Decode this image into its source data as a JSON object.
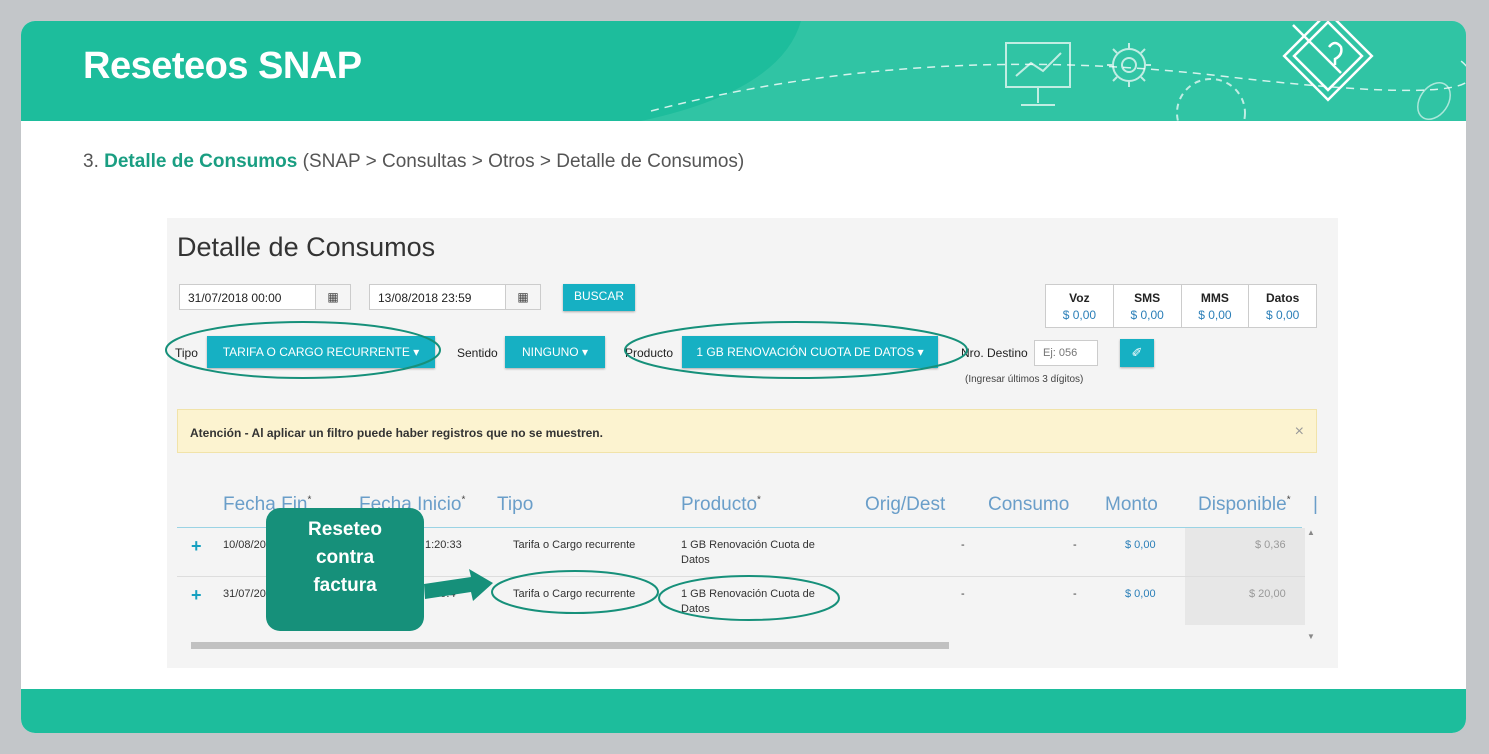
{
  "slide": {
    "title": "Reseteos SNAP",
    "subtitle_num": "3.",
    "subtitle_highlight": "Detalle de Consumos",
    "subtitle_path": "(SNAP > Consultas > Otros > Detalle de Consumos)",
    "accent_color": "#1dbd9c",
    "decor_icons": [
      "presentation-board-icon",
      "gear-icon",
      "pencil-question-icon",
      "mouse-icon"
    ]
  },
  "app": {
    "title": "Detalle de Consumos",
    "date_from": "31/07/2018 00:00",
    "date_to": "13/08/2018 23:59",
    "calendar_icon": "calendar-icon",
    "search_label": "BUSCAR",
    "summary": [
      {
        "label": "Voz",
        "value": "$ 0,00"
      },
      {
        "label": "SMS",
        "value": "$ 0,00"
      },
      {
        "label": "MMS",
        "value": "$ 0,00"
      },
      {
        "label": "Datos",
        "value": "$ 0,00"
      }
    ],
    "filters": {
      "tipo_label": "Tipo",
      "tipo_value": "TARIFA O CARGO RECURRENTE",
      "sentido_label": "Sentido",
      "sentido_value": "NINGUNO",
      "producto_label": "Producto",
      "producto_value": "1 GB RENOVACIÓN CUOTA DE DATOS",
      "nro_destino_label": "Nro. Destino",
      "nro_destino_placeholder": "Ej: 056",
      "nro_destino_hint": "(Ingresar últimos 3 dígitos)",
      "clear_icon": "eraser-icon"
    },
    "alert": {
      "text": "Atención - Al aplicar un filtro puede haber registros que no se muestren.",
      "close": "×"
    },
    "table": {
      "columns": [
        "Fecha Fin",
        "Fecha Inicio",
        "Tipo",
        "Producto",
        "Orig/Dest",
        "Consumo",
        "Monto",
        "Disponible"
      ],
      "rows": [
        {
          "fecha_fin": "10/08/20",
          "fecha_inicio": "1:20:33",
          "tipo": "Tarifa o Cargo recurrente",
          "producto": "1 GB Renovación Cuota de Datos",
          "orig_dest": "-",
          "consumo": "-",
          "monto": "$ 0,00",
          "disponible": "$ 0,36"
        },
        {
          "fecha_fin": "31/07/20",
          "fecha_inicio": "9:39:4",
          "tipo": "Tarifa o Cargo recurrente",
          "producto": "1 GB Renovación Cuota de Datos",
          "orig_dest": "-",
          "consumo": "-",
          "monto": "$ 0,00",
          "disponible": "$ 20,00"
        }
      ]
    }
  },
  "callout": {
    "line1": "Reseteo",
    "line2": "contra",
    "line3": "factura"
  }
}
